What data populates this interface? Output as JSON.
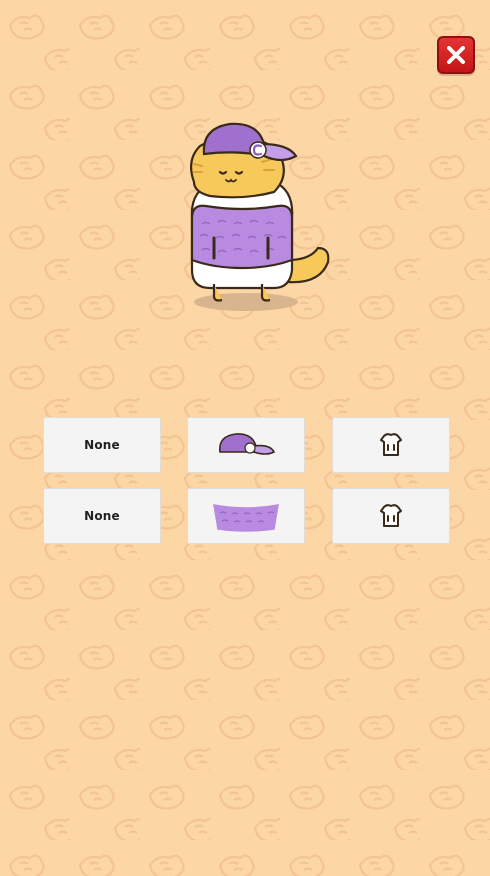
{
  "screen": {
    "background_color": "#fdd6a6",
    "pattern_icon": "taiyaki-fish-icon"
  },
  "close_button": {
    "icon": "close-x-icon",
    "color": "#d42424"
  },
  "character": {
    "icon": "cat-character",
    "hat": "purple-baseball-cap",
    "shirt": "purple-shirt"
  },
  "slots": {
    "row1": [
      {
        "label": "None"
      },
      {
        "icon": "purple-cap-icon"
      },
      {
        "icon": "shirt-outline-icon"
      }
    ],
    "row2": [
      {
        "label": "None"
      },
      {
        "icon": "purple-fabric-icon"
      },
      {
        "icon": "shirt-outline-icon"
      }
    ]
  }
}
